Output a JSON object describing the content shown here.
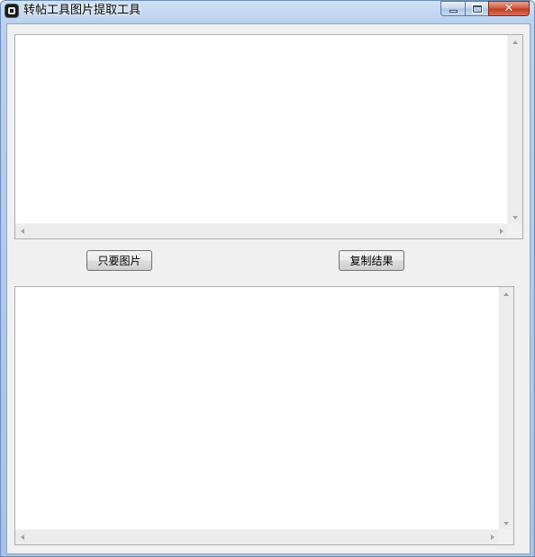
{
  "window": {
    "title": "转帖工具图片提取工具",
    "close_glyph": "✕"
  },
  "buttons": {
    "images_only": "只要图片",
    "copy_result": "复制结果"
  },
  "top_textbox": {
    "value": ""
  },
  "bottom_textbox": {
    "value": ""
  },
  "colors": {
    "titlebar": "#b9d1ee",
    "client_bg": "#f0f0f0",
    "close_button": "#c43a1f"
  },
  "icons": [
    "app-icon",
    "minimize-icon",
    "maximize-icon",
    "close-icon",
    "scroll-up-icon",
    "scroll-down-icon",
    "scroll-left-icon",
    "scroll-right-icon"
  ]
}
